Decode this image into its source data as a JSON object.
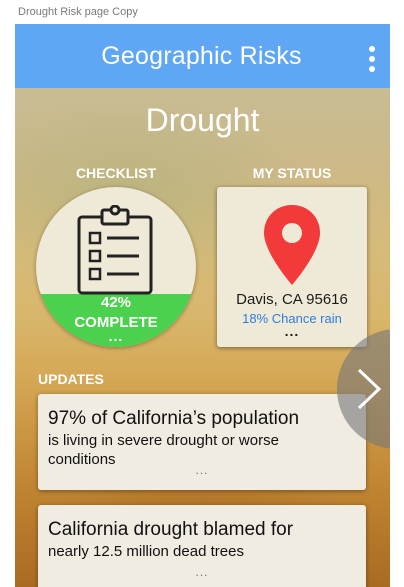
{
  "frame": {
    "label": "Drought Risk page Copy"
  },
  "appbar": {
    "title": "Geographic Risks",
    "menu_icon": "more-vert-icon"
  },
  "page": {
    "title": "Drought"
  },
  "checklist": {
    "label": "CHECKLIST",
    "icon": "clipboard-checklist-icon",
    "progress_percent": "42%",
    "progress_fraction": 0.42,
    "progress_text": "COMPLETE",
    "more": "...",
    "fill_color": "#4cd14f"
  },
  "status": {
    "label": "MY STATUS",
    "icon": "map-pin-icon",
    "location": "Davis, CA 95616",
    "rain_chance": "18% Chance rain",
    "more": "...",
    "pin_color": "#f23a3a",
    "rain_color": "#2f7be0"
  },
  "updates": {
    "label": "UPDATES",
    "items": [
      {
        "headline": "97% of California’s population",
        "body": "is living in severe drought or worse conditions",
        "more": "..."
      },
      {
        "headline": "California drought blamed for",
        "body": "nearly 12.5 million dead trees",
        "more": "..."
      }
    ]
  },
  "nav": {
    "next_icon": "chevron-right-icon"
  },
  "colors": {
    "appbar": "#5fa7f5"
  }
}
